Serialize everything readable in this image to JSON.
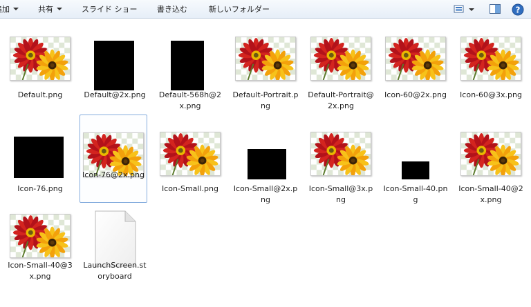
{
  "toolbar": {
    "add_label": "追加",
    "share_label": "共有",
    "slideshow_label": "スライド ショー",
    "burn_label": "書き込む",
    "new_folder_label": "新しいフォルダー",
    "view_icon": "view-options-icon",
    "preview_icon": "preview-pane-icon",
    "help_icon": "help-icon",
    "help_text": "?"
  },
  "files": [
    {
      "name": "Default.png",
      "thumb": "flower"
    },
    {
      "name": "Default@2x.png",
      "thumb": "black"
    },
    {
      "name": "Default-568h@2x.png",
      "thumb": "black"
    },
    {
      "name": "Default-Portrait.png",
      "thumb": "flower"
    },
    {
      "name": "Default-Portrait@2x.png",
      "thumb": "flower"
    },
    {
      "name": "Icon-60@2x.png",
      "thumb": "flower"
    },
    {
      "name": "Icon-60@3x.png",
      "thumb": "flower"
    },
    {
      "name": "Icon-76.png",
      "thumb": "black"
    },
    {
      "name": "Icon-76@2x.png",
      "thumb": "flower",
      "selected": true
    },
    {
      "name": "Icon-Small.png",
      "thumb": "flower"
    },
    {
      "name": "Icon-Small@2x.png",
      "thumb": "black"
    },
    {
      "name": "Icon-Small@3x.png",
      "thumb": "flower"
    },
    {
      "name": "Icon-Small-40.png",
      "thumb": "black"
    },
    {
      "name": "Icon-Small-40@2x.png",
      "thumb": "flower"
    },
    {
      "name": "Icon-Small-40@3x.png",
      "thumb": "flower"
    },
    {
      "name": "LaunchScreen.storyboard",
      "thumb": "document"
    }
  ]
}
